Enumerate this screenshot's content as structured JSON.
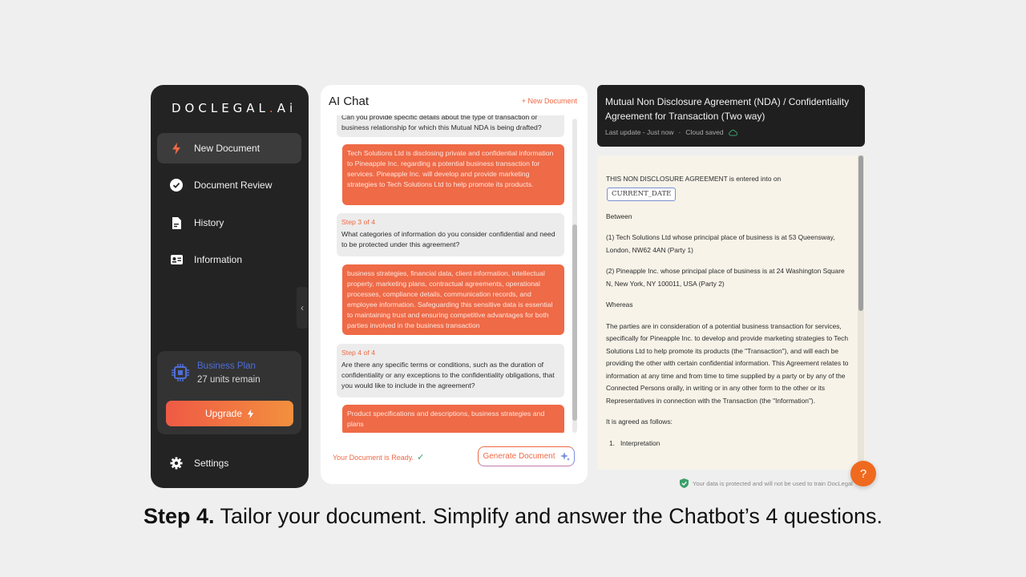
{
  "sidebar": {
    "logo_prefix": "DOCLEGAL",
    "logo_dot": ".",
    "logo_suffix": "Ai",
    "items": [
      {
        "label": "New Document",
        "icon": "bolt-icon",
        "active": true
      },
      {
        "label": "Document Review",
        "icon": "check-circle-icon",
        "active": false
      },
      {
        "label": "History",
        "icon": "document-icon",
        "active": false
      },
      {
        "label": "Information",
        "icon": "id-card-icon",
        "active": false
      }
    ],
    "plan": {
      "name": "Business Plan",
      "units": "27 units remain",
      "upgrade_label": "Upgrade"
    },
    "settings_label": "Settings"
  },
  "chat": {
    "title": "AI Chat",
    "new_document": "+ New Document",
    "messages": [
      {
        "role": "bot",
        "step": "",
        "text": "Can you provide specific details about the type of transaction or business relationship for which this Mutual NDA is being drafted?"
      },
      {
        "role": "user",
        "text": "Tech Solutions Ltd is disclosing private and confidential information to Pineapple Inc. regarding a potential business transaction for services. Pineapple Inc. will develop and provide marketing strategies to Tech Solutions Ltd to help promote its products."
      },
      {
        "role": "bot",
        "step": "Step 3 of 4",
        "text": "What categories of information do you consider confidential and need to be protected under this agreement?"
      },
      {
        "role": "user",
        "text": "business strategies, financial data, client information, intellectual property, marketing plans, contractual agreements, operational processes, compliance details, communication records, and employee information. Safeguarding this sensitive data is essential to maintaining trust and ensuring competitive advantages for both parties involved in the business transaction"
      },
      {
        "role": "bot",
        "step": "Step 4 of 4",
        "text": "Are there any specific terms or conditions, such as the duration of confidentiality or any exceptions to the confidentiality obligations, that you would like to include in the agreement?"
      },
      {
        "role": "user",
        "text": "Product specifications and descriptions, business strategies and plans"
      }
    ],
    "ready_text": "Your Document is Ready.",
    "generate_label": "Generate Document"
  },
  "document": {
    "title": "Mutual Non Disclosure Agreement (NDA) / Confidentiality Agreement for Transaction (Two way)",
    "last_update": "Last update - Just now",
    "separator": "·",
    "cloud": "Cloud saved",
    "intro": "THIS NON DISCLOSURE AGREEMENT is entered into on",
    "date_tag": "CURRENT_DATE",
    "between": "Between",
    "party1": "(1) Tech Solutions Ltd whose principal place of business is at 53 Queensway, London, NW62 4AN (Party 1)",
    "party2": "(2) Pineapple Inc. whose principal place of business is at 24 Washington Square N, New York, NY 100011, USA (Party 2)",
    "whereas": "Whereas",
    "recital": "The parties are in consideration of a potential business transaction for services, specifically for Pineapple Inc. to develop and provide marketing strategies to Tech Solutions Ltd to help promote its products (the \"Transaction\"), and will each be providing the other with certain confidential information. This Agreement relates to information at any time and from time to time supplied by a party or by any of the Connected Persons orally, in writing or in any other form to the other or its Representatives in connection with the Transaction (the \"Information\").",
    "agreed": "It is agreed as follows:",
    "clause1_num": "1.",
    "clause1": "Interpretation",
    "protected_note": "Your data is protected and will not be used to train DocLegal",
    "help": "?"
  },
  "caption": {
    "bold": "Step 4.",
    "text": " Tailor your document. Simplify and answer the Chatbot’s 4 questions."
  },
  "colors": {
    "accent": "#ef6a46",
    "sidebar_bg": "#232323",
    "doc_bg": "#f7f3e9",
    "plan_blue": "#4e6ed8"
  }
}
